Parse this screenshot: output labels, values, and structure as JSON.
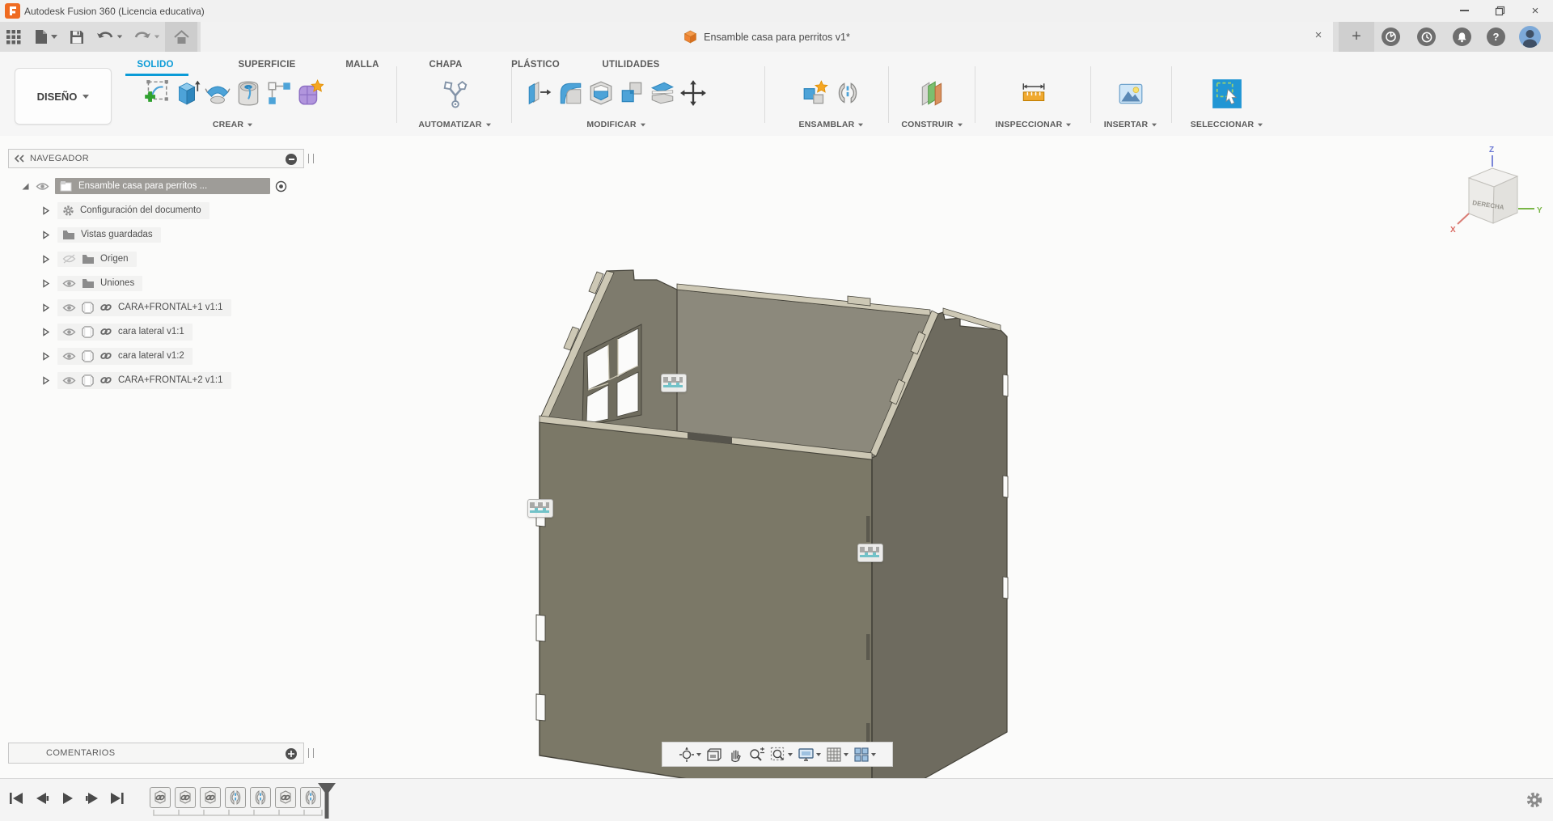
{
  "titlebar": {
    "app_title": "Autodesk Fusion 360 (Licencia educativa)"
  },
  "tabstrip": {
    "doc_title": "Ensamble casa para perritos v1*"
  },
  "glyphs": {
    "close": "×",
    "plus": "+",
    "help": "?",
    "minimize": "–"
  },
  "workspace": {
    "label": "DISEÑO"
  },
  "ribbon": {
    "tabs": [
      {
        "label": "SOLIDO",
        "active": true
      },
      {
        "label": "SUPERFICIE"
      },
      {
        "label": "MALLA"
      },
      {
        "label": "CHAPA"
      },
      {
        "label": "PLÁSTICO"
      },
      {
        "label": "UTILIDADES"
      }
    ],
    "groups": [
      {
        "label": "CREAR"
      },
      {
        "label": "AUTOMATIZAR"
      },
      {
        "label": "MODIFICAR"
      },
      {
        "label": "ENSAMBLAR"
      },
      {
        "label": "CONSTRUIR"
      },
      {
        "label": "INSPECCIONAR"
      },
      {
        "label": "INSERTAR"
      },
      {
        "label": "SELECCIONAR"
      }
    ]
  },
  "navigator": {
    "title": "NAVEGADOR",
    "root_label": "Ensamble casa para perritos ...",
    "items": [
      {
        "label": "Configuración del documento",
        "icon": "gear-icon",
        "visible": null
      },
      {
        "label": "Vistas guardadas",
        "icon": "folder-icon",
        "visible": null
      },
      {
        "label": "Origen",
        "icon": "folder-icon",
        "visible": false
      },
      {
        "label": "Uniones",
        "icon": "folder-icon",
        "visible": true
      },
      {
        "label": "CARA+FRONTAL+1 v1:1",
        "icon": "linked-body-icon",
        "visible": true
      },
      {
        "label": "cara lateral v1:1",
        "icon": "linked-body-icon",
        "visible": true
      },
      {
        "label": "cara lateral v1:2",
        "icon": "linked-body-icon",
        "visible": true
      },
      {
        "label": "CARA+FRONTAL+2 v1:1",
        "icon": "linked-body-icon",
        "visible": true
      }
    ]
  },
  "comments": {
    "title": "COMENTARIOS"
  },
  "viewcube": {
    "face_label": "DERECHA",
    "axis_x": "X",
    "axis_y": "Y",
    "axis_z": "Z"
  },
  "timeline": {
    "items": [
      {
        "type": "linked-component"
      },
      {
        "type": "linked-component"
      },
      {
        "type": "linked-component"
      },
      {
        "type": "joint"
      },
      {
        "type": "joint"
      },
      {
        "type": "linked-component"
      },
      {
        "type": "joint"
      }
    ]
  },
  "colors": {
    "accent_blue": "#0a9bd7",
    "selection_teal": "#7cc6cb",
    "model_face_front": "#7b7867",
    "model_face_right": "#6e6b5f",
    "model_face_interior": "#8c897c",
    "model_gable_interior": "#7e7b6d",
    "model_edge_cream": "#cdc8b5",
    "avatar_blue": "#7da9d8"
  }
}
